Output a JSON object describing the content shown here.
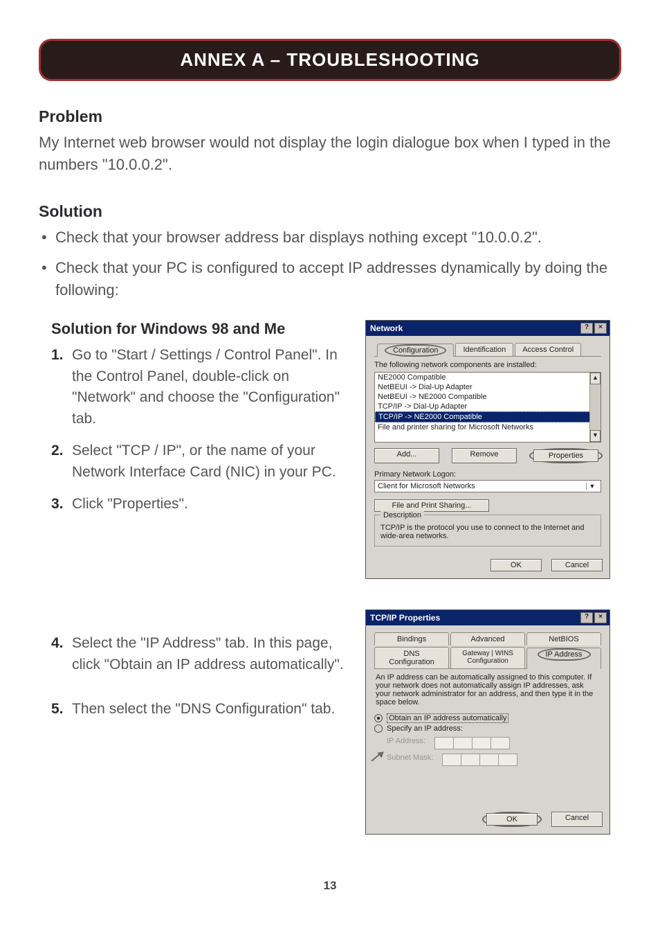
{
  "banner": {
    "title": "ANNEX A – TROUBLESHOOTING"
  },
  "problem": {
    "heading": "Problem",
    "text": "My Internet web browser would not display the login dialogue box when I typed in the numbers \"10.0.0.2\"."
  },
  "solution": {
    "heading": "Solution",
    "bullets": [
      "Check that your browser address bar displays nothing except \"10.0.0.2\".",
      "Check that your PC is configured to accept IP addresses dynamically by doing the following:"
    ]
  },
  "win98": {
    "heading": "Solution for Windows 98 and Me",
    "steps": [
      "Go to \"Start / Settings / Control Panel\". In the Control Panel, double-click on \"Network\" and choose the \"Configuration\" tab.",
      "Select \"TCP / IP\", or the name of your Network Interface Card (NIC) in your PC.",
      "Click \"Properties\".",
      "Select the \"IP Address\" tab. In this page, click \"Obtain an IP address automatically\".",
      "Then select the \"DNS Configuration\" tab."
    ]
  },
  "dlg_network": {
    "title": "Network",
    "help": "?",
    "close": "×",
    "tabs": {
      "config": "Configuration",
      "ident": "Identification",
      "access": "Access Control"
    },
    "list_caption": "The following network components are installed:",
    "items": [
      "NE2000 Compatible",
      "NetBEUI -> Dial-Up Adapter",
      "NetBEUI -> NE2000 Compatible",
      "TCP/IP -> Dial-Up Adapter",
      "TCP/IP -> NE2000 Compatible",
      "File and printer sharing for Microsoft Networks"
    ],
    "buttons": {
      "add": "Add...",
      "remove": "Remove",
      "properties": "Properties"
    },
    "primary_label": "Primary Network Logon:",
    "primary_value": "Client for Microsoft Networks",
    "file_print": "File and Print Sharing...",
    "desc_label": "Description",
    "desc_text": "TCP/IP is the protocol you use to connect to the Internet and wide-area networks.",
    "ok": "OK",
    "cancel": "Cancel"
  },
  "dlg_tcpip": {
    "title": "TCP/IP Properties",
    "help": "?",
    "close": "×",
    "tabs_top": {
      "bindings": "Bindings",
      "advanced": "Advanced",
      "netbios": "NetBIOS"
    },
    "tabs_bot": {
      "dns": "DNS Configuration",
      "gateway": "Gateway",
      "wins": "WINS Configuration",
      "ip": "IP Address"
    },
    "blurb": "An IP address can be automatically assigned to this computer. If your network does not automatically assign IP addresses, ask your network administrator for an address, and then type it in the space below.",
    "radio_auto": "Obtain an IP address automatically",
    "radio_spec": "Specify an IP address:",
    "ip_label": "IP Address:",
    "mask_label": "Subnet Mask:",
    "ok": "OK",
    "cancel": "Cancel"
  },
  "page_number": "13"
}
